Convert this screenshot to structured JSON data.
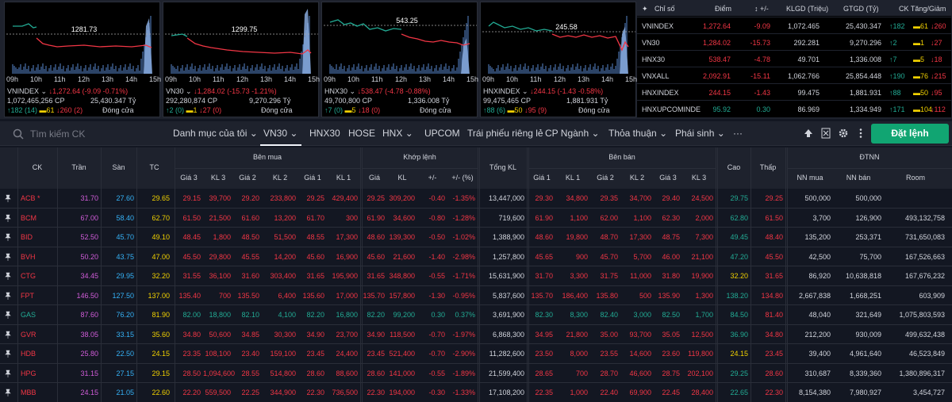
{
  "charts": [
    {
      "label": "VNINDEX",
      "ref": "1281.73",
      "chg": "↓1,272.64 (-9.09 -0.71%)",
      "vol": "1,072,465,256 CP",
      "val": "25,430.347 Tỷ",
      "up": "↑182 (14)",
      "ref_c": "▬61",
      "dn": "↓260 (2)",
      "status": "Đóng cửa"
    },
    {
      "label": "VN30",
      "ref": "1299.75",
      "chg": "↓1,284.02 (-15.73 -1.21%)",
      "vol": "292,280,874 CP",
      "val": "9,270.296 Tỷ",
      "up": "↑2 (0)",
      "ref_c": "▬1",
      "dn": "↓27 (0)",
      "status": "Đóng cửa"
    },
    {
      "label": "HNX30",
      "ref": "543.25",
      "chg": "↓538.47 (-4.78 -0.88%)",
      "vol": "49,700,800 CP",
      "val": "1,336.008 Tỷ",
      "up": "↑7 (0)",
      "ref_c": "▬5",
      "dn": "↓18 (0)",
      "status": "Đóng cửa"
    },
    {
      "label": "HNXINDEX",
      "ref": "245.58",
      "chg": "↓244.15 (-1.43 -0.58%)",
      "vol": "99,475,465 CP",
      "val": "1,881.931 Tỷ",
      "up": "↑88 (6)",
      "ref_c": "▬50",
      "dn": "↓95 (9)",
      "status": "Đóng cửa"
    }
  ],
  "time_labels": [
    "09h",
    "10h",
    "11h",
    "12h",
    "13h",
    "14h",
    "15h"
  ],
  "index_table": {
    "headers": [
      "Chỉ số",
      "Điểm",
      "+/-",
      "KLGD (Triệu)",
      "GTGD (Tỷ)",
      "CK Tăng/Giảm"
    ],
    "rows": [
      {
        "name": "VNINDEX",
        "point": "1,272.64",
        "chg": "-9.09",
        "vol": "1,072.465",
        "val": "25,430.347",
        "up": "↑182",
        "ref": "▬61",
        "dn": "↓260",
        "c": "dn"
      },
      {
        "name": "VN30",
        "point": "1,284.02",
        "chg": "-15.73",
        "vol": "292.281",
        "val": "9,270.296",
        "up": "↑2",
        "ref": "▬1",
        "dn": "↓27",
        "c": "dn"
      },
      {
        "name": "HNX30",
        "point": "538.47",
        "chg": "-4.78",
        "vol": "49.701",
        "val": "1,336.008",
        "up": "↑7",
        "ref": "▬5",
        "dn": "↓18",
        "c": "dn"
      },
      {
        "name": "VNXALL",
        "point": "2,092.91",
        "chg": "-15.11",
        "vol": "1,062.766",
        "val": "25,854.448",
        "up": "↑190",
        "ref": "▬76",
        "dn": "↓215",
        "c": "dn"
      },
      {
        "name": "HNXINDEX",
        "point": "244.15",
        "chg": "-1.43",
        "vol": "99.475",
        "val": "1,881.931",
        "up": "↑88",
        "ref": "▬50",
        "dn": "↓95",
        "c": "dn"
      },
      {
        "name": "HNXUPCOMINDE",
        "point": "95.92",
        "chg": "0.30",
        "vol": "86.969",
        "val": "1,334.949",
        "up": "↑171",
        "ref": "▬104",
        "dn": "↓112",
        "c": "up"
      }
    ]
  },
  "toolbar": {
    "search_placeholder": "Tìm kiếm CK",
    "tabs": [
      "Danh mục của tôi",
      "VN30",
      "HNX30",
      "HOSE",
      "HNX",
      "UPCOM",
      "Trái phiếu riêng lẻ",
      "CP Ngành",
      "Thỏa thuận",
      "Phái sinh",
      "···"
    ],
    "order_button": "Đặt lệnh"
  },
  "table": {
    "headers": {
      "ck": "CK",
      "tran": "Trần",
      "san": "Sàn",
      "tc": "TC",
      "ben_mua": "Bên mua",
      "khop_lenh": "Khớp lệnh",
      "tong_kl": "Tổng KL",
      "ben_ban": "Bên bán",
      "cao": "Cao",
      "thap": "Thấp",
      "dtnn": "ĐTNN",
      "gia3": "Giá 3",
      "kl3": "KL 3",
      "gia2": "Giá 2",
      "kl2": "KL 2",
      "gia1": "Giá 1",
      "kl1": "KL 1",
      "gia": "Giá",
      "kl": "KL",
      "pm": "+/-",
      "pct": "+/- (%)",
      "nn_mua": "NN mua",
      "nn_ban": "NN bán",
      "room": "Room"
    },
    "rows": [
      [
        "ACB *",
        "31.70",
        "27.60",
        "29.65",
        "29.15",
        "39,700",
        "29.20",
        "233,800",
        "29.25",
        "429,400",
        "29.25",
        "309,200",
        "-0.40",
        "-1.35%",
        "13,447,000",
        "29.30",
        "34,800",
        "29.35",
        "34,700",
        "29.40",
        "24,500",
        "29.75",
        "29.25",
        "500,000",
        "500,000",
        ""
      ],
      [
        "BCM",
        "67.00",
        "58.40",
        "62.70",
        "61.50",
        "21,500",
        "61.60",
        "13,200",
        "61.70",
        "300",
        "61.90",
        "34,600",
        "-0.80",
        "-1.28%",
        "719,600",
        "61.90",
        "1,100",
        "62.00",
        "1,100",
        "62.30",
        "2,000",
        "62.80",
        "61.50",
        "3,700",
        "126,900",
        "493,132,758"
      ],
      [
        "BID",
        "52.50",
        "45.70",
        "49.10",
        "48.45",
        "1,800",
        "48.50",
        "51,500",
        "48.55",
        "17,300",
        "48.60",
        "139,300",
        "-0.50",
        "-1.02%",
        "1,388,900",
        "48.60",
        "19,800",
        "48.70",
        "17,300",
        "48.75",
        "7,300",
        "49.45",
        "48.40",
        "135,200",
        "253,371",
        "731,650,083"
      ],
      [
        "BVH",
        "50.20",
        "43.75",
        "47.00",
        "45.50",
        "29,800",
        "45.55",
        "14,200",
        "45.60",
        "16,900",
        "45.60",
        "21,600",
        "-1.40",
        "-2.98%",
        "1,257,800",
        "45.65",
        "900",
        "45.70",
        "5,700",
        "46.00",
        "21,100",
        "47.20",
        "45.50",
        "42,500",
        "75,700",
        "167,526,663"
      ],
      [
        "CTG",
        "34.45",
        "29.95",
        "32.20",
        "31.55",
        "36,100",
        "31.60",
        "303,400",
        "31.65",
        "195,900",
        "31.65",
        "348,800",
        "-0.55",
        "-1.71%",
        "15,631,900",
        "31.70",
        "3,300",
        "31.75",
        "11,000",
        "31.80",
        "19,900",
        "32.20",
        "31.65",
        "86,920",
        "10,638,818",
        "167,676,232"
      ],
      [
        "FPT",
        "146.50",
        "127.50",
        "137.00",
        "135.40",
        "700",
        "135.50",
        "6,400",
        "135.60",
        "17,000",
        "135.70",
        "157,800",
        "-1.30",
        "-0.95%",
        "5,837,600",
        "135.70",
        "186,400",
        "135.80",
        "500",
        "135.90",
        "1,300",
        "138.20",
        "134.80",
        "2,667,838",
        "1,668,251",
        "603,909"
      ],
      [
        "GAS",
        "87.60",
        "76.20",
        "81.90",
        "82.00",
        "18,800",
        "82.10",
        "4,100",
        "82.20",
        "16,800",
        "82.20",
        "99,200",
        "0.30",
        "0.37%",
        "3,691,900",
        "82.30",
        "8,300",
        "82.40",
        "3,000",
        "82.50",
        "1,700",
        "84.50",
        "81.40",
        "48,040",
        "321,649",
        "1,075,803,593"
      ],
      [
        "GVR",
        "38.05",
        "33.15",
        "35.60",
        "34.80",
        "50,600",
        "34.85",
        "30,300",
        "34.90",
        "23,700",
        "34.90",
        "118,500",
        "-0.70",
        "-1.97%",
        "6,868,300",
        "34.95",
        "21,800",
        "35.00",
        "93,700",
        "35.05",
        "12,500",
        "36.90",
        "34.80",
        "212,200",
        "930,009",
        "499,632,438"
      ],
      [
        "HDB",
        "25.80",
        "22.50",
        "24.15",
        "23.35",
        "108,100",
        "23.40",
        "159,100",
        "23.45",
        "24,400",
        "23.45",
        "521,400",
        "-0.70",
        "-2.90%",
        "11,282,600",
        "23.50",
        "8,000",
        "23.55",
        "14,600",
        "23.60",
        "119,800",
        "24.15",
        "23.45",
        "39,400",
        "4,961,640",
        "46,523,849"
      ],
      [
        "HPG",
        "31.15",
        "27.15",
        "29.15",
        "28.50",
        "1,094,600",
        "28.55",
        "514,800",
        "28.60",
        "88,600",
        "28.60",
        "141,000",
        "-0.55",
        "-1.89%",
        "21,599,400",
        "28.65",
        "700",
        "28.70",
        "46,600",
        "28.75",
        "202,100",
        "29.25",
        "28.60",
        "310,687",
        "8,339,360",
        "1,380,896,317"
      ],
      [
        "MBB",
        "24.15",
        "21.05",
        "22.60",
        "22.20",
        "559,500",
        "22.25",
        "344,900",
        "22.30",
        "736,500",
        "22.30",
        "194,000",
        "-0.30",
        "-1.33%",
        "17,108,200",
        "22.35",
        "1,000",
        "22.40",
        "69,900",
        "22.45",
        "28,400",
        "22.65",
        "22.30",
        "8,154,380",
        "7,980,927",
        "3,454,727"
      ]
    ]
  }
}
